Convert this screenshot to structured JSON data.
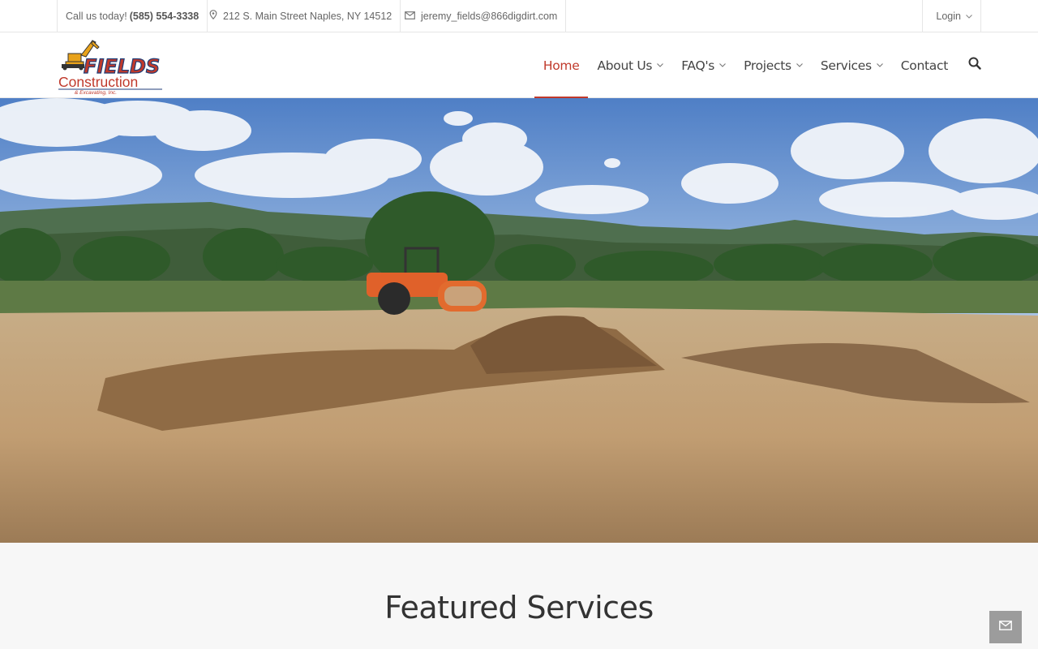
{
  "topbar": {
    "call_label": "Call us today!",
    "phone": "(585) 554-3338",
    "address": "212 S. Main Street Naples, NY 14512",
    "email": "jeremy_fields@866digdirt.com",
    "login_label": "Login",
    "icons": {
      "address": "map-pin-icon",
      "email": "envelope-icon",
      "login": "chevron-down-icon"
    }
  },
  "logo": {
    "line1": "FIELDS",
    "line2": "Construction",
    "line3": "& Excavating, Inc."
  },
  "nav": {
    "items": [
      {
        "label": "Home",
        "active": true,
        "dropdown": false
      },
      {
        "label": "About Us",
        "active": false,
        "dropdown": true
      },
      {
        "label": "FAQ's",
        "active": false,
        "dropdown": true
      },
      {
        "label": "Projects",
        "active": false,
        "dropdown": true
      },
      {
        "label": "Services",
        "active": false,
        "dropdown": true
      },
      {
        "label": "Contact",
        "active": false,
        "dropdown": false
      }
    ],
    "search_icon": "search-icon"
  },
  "featured": {
    "title": "Featured Services"
  },
  "colors": {
    "accent": "#c0392b",
    "float_button": "#9c9c9c"
  },
  "float_button_icon": "envelope-icon"
}
